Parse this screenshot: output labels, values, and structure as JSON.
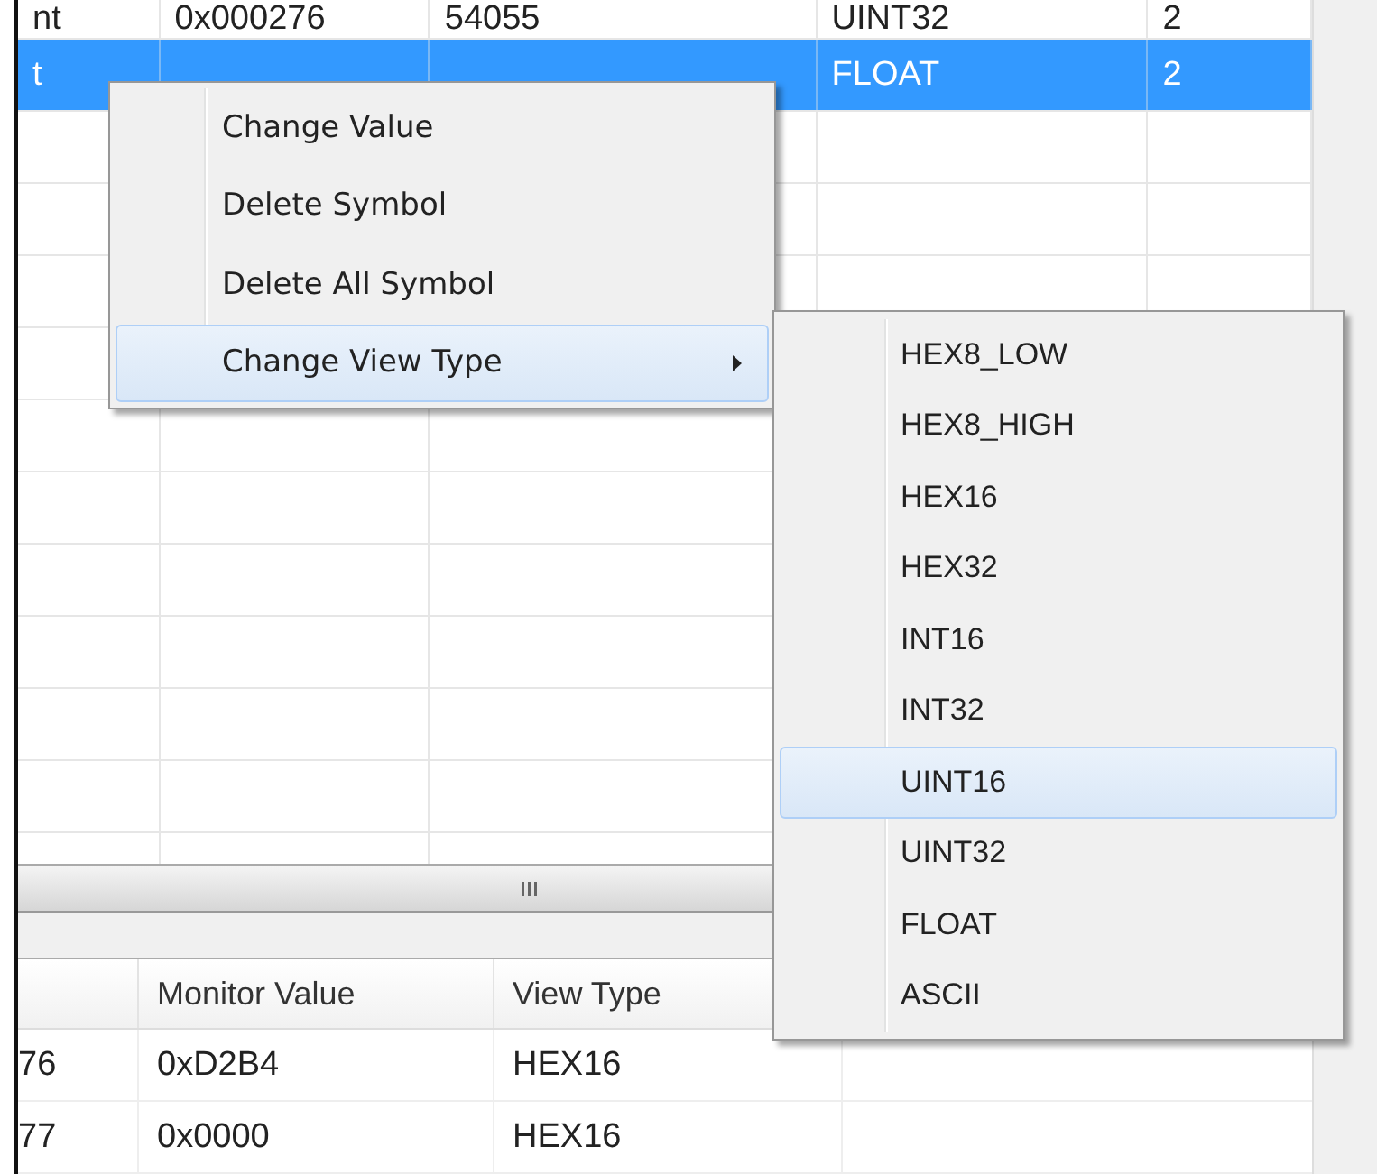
{
  "upper_table": {
    "rows": [
      {
        "selected": false,
        "cells": [
          "nt",
          "0x000276",
          "54055",
          "UINT32",
          "2"
        ]
      },
      {
        "selected": true,
        "cells": [
          "t",
          null,
          null,
          "FLOAT",
          "2"
        ]
      }
    ]
  },
  "lower_table": {
    "columns": [
      null,
      "Monitor Value",
      "View Type"
    ],
    "rows": [
      {
        "cells": [
          "76",
          "0xD2B4",
          "HEX16"
        ]
      },
      {
        "cells": [
          "77",
          "0x0000",
          "HEX16"
        ]
      }
    ]
  },
  "context_menu": {
    "items": [
      {
        "label": "Change Value",
        "selected": false,
        "submenu": false
      },
      {
        "label": "Delete Symbol",
        "selected": false,
        "submenu": false
      },
      {
        "label": "Delete All Symbol",
        "selected": false,
        "submenu": false
      },
      {
        "label": "Change View Type",
        "selected": true,
        "submenu": true
      }
    ]
  },
  "submenu": {
    "items": [
      {
        "label": "HEX8_LOW",
        "selected": false
      },
      {
        "label": "HEX8_HIGH",
        "selected": false
      },
      {
        "label": "HEX16",
        "selected": false
      },
      {
        "label": "HEX32",
        "selected": false
      },
      {
        "label": "INT16",
        "selected": false
      },
      {
        "label": "INT32",
        "selected": false
      },
      {
        "label": "UINT16",
        "selected": true
      },
      {
        "label": "UINT32",
        "selected": false
      },
      {
        "label": "FLOAT",
        "selected": false
      },
      {
        "label": "ASCII",
        "selected": false
      }
    ]
  }
}
